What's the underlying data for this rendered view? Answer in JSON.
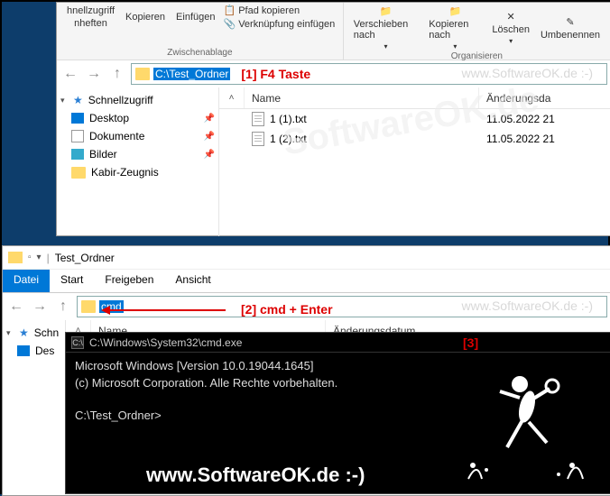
{
  "window1": {
    "ribbon": {
      "group1_items": [
        "hnellzugriff",
        "nheften"
      ],
      "group1_copy": "Kopieren",
      "group1_paste": "Einfügen",
      "group1_shortcut": "Verknüpfung einfügen",
      "group1_pathcopy": "Pfad kopieren",
      "group1_label": "Zwischenablage",
      "group2_move": "Verschieben nach",
      "group2_copy": "Kopieren nach",
      "group2_delete": "Löschen",
      "group2_rename": "Umbenennen",
      "group2_label": "Organisieren"
    },
    "address": "C:\\Test_Ordner",
    "annot1": "[1] F4 Taste",
    "sidebar": {
      "quick": "Schnellzugriff",
      "desktop": "Desktop",
      "documents": "Dokumente",
      "pictures": "Bilder",
      "item4": "Kabir-Zeugnis"
    },
    "columns": {
      "name": "Name",
      "date": "Änderungsda"
    },
    "files": [
      {
        "name": "1 (1).txt",
        "date": "11.05.2022 21"
      },
      {
        "name": "1 (2).txt",
        "date": "11.05.2022 21"
      }
    ]
  },
  "window2": {
    "title": "Test_Ordner",
    "tabs": {
      "file": "Datei",
      "start": "Start",
      "share": "Freigeben",
      "view": "Ansicht"
    },
    "address_sel": "cmd",
    "annot2": "[2] cmd + Enter",
    "columns": {
      "name": "Name",
      "date": "Änderungsdatum"
    },
    "sidebar_quick": "Schn",
    "sidebar_desktop": "Des"
  },
  "cmd": {
    "title": "C:\\Windows\\System32\\cmd.exe",
    "annot3": "[3]",
    "line1": "Microsoft Windows [Version 10.0.19044.1645]",
    "line2": "(c) Microsoft Corporation. Alle Rechte vorbehalten.",
    "prompt": "C:\\Test_Ordner>"
  },
  "watermark_inline": "www.SoftwareOK.de :-)",
  "watermark_big": "SoftwareOK.de",
  "footer": "www.SoftwareOK.de :-)"
}
